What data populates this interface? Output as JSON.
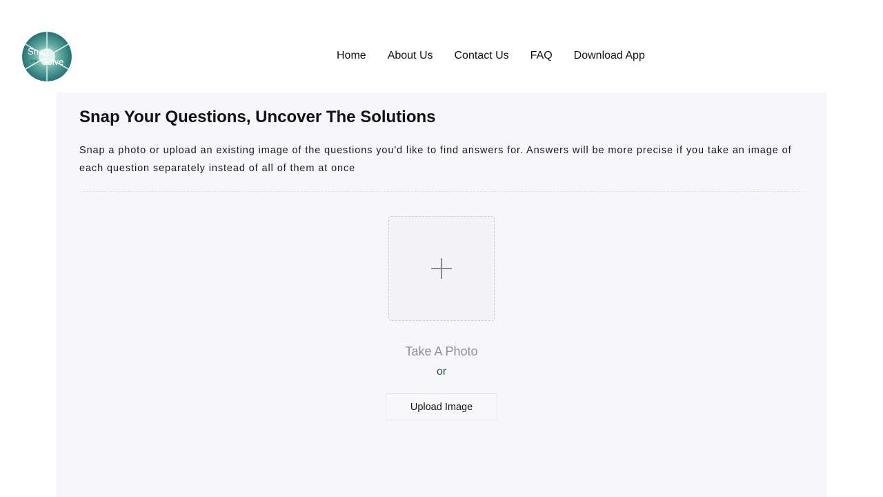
{
  "brand": {
    "logo_icon": "snap-and-solve-logo",
    "logo_text_primary": "Snap",
    "logo_text_small": "and",
    "logo_text_secondary": "Solve",
    "accent_color": "#1e5568"
  },
  "nav": {
    "items": [
      {
        "label": "Home"
      },
      {
        "label": "About Us"
      },
      {
        "label": "Contact Us"
      },
      {
        "label": "FAQ"
      },
      {
        "label": "Download App"
      }
    ]
  },
  "main": {
    "title": "Snap Your Questions, Uncover The Solutions",
    "description": "Snap a photo or upload an existing image of the questions you'd like to find answers for. Answers will be more precise if you take an image of each question separately instead of all of them at once",
    "uploader_icon": "plus-icon",
    "take_photo_label": "Take A Photo",
    "or_label": "or",
    "upload_button_label": "Upload Image"
  }
}
